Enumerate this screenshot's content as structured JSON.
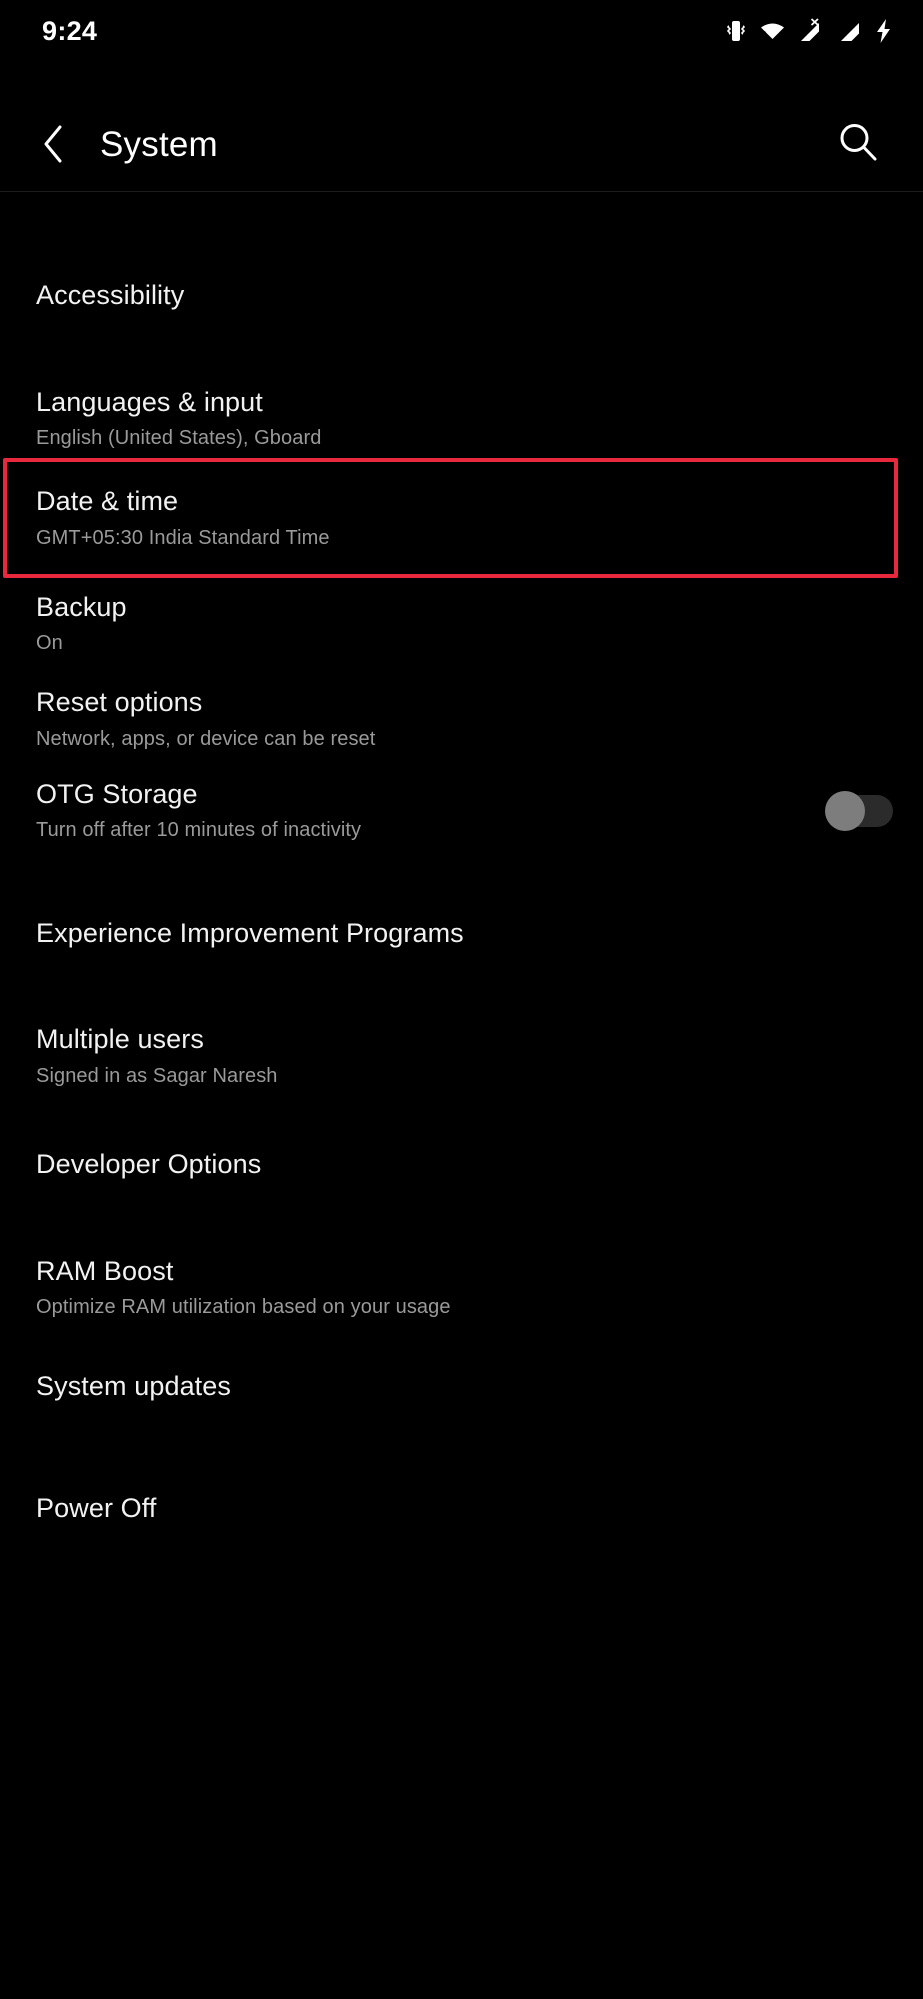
{
  "status_bar": {
    "time": "9:24",
    "icons": [
      "vibrate-icon",
      "wifi-icon",
      "signal-no-service-icon",
      "signal-bars-icon",
      "charging-bolt-icon"
    ]
  },
  "toolbar": {
    "back_icon": "chevron-left-icon",
    "title": "System",
    "search_icon": "search-icon"
  },
  "highlight": {
    "target": "Date & time",
    "color": "#e8283c"
  },
  "list": {
    "items": [
      {
        "title": "Accessibility",
        "subtitle": ""
      },
      {
        "title": "Languages & input",
        "subtitle": "English (United States), Gboard"
      },
      {
        "title": "Date & time",
        "subtitle": "GMT+05:30 India Standard Time"
      },
      {
        "title": "Backup",
        "subtitle": "On"
      },
      {
        "title": "Reset options",
        "subtitle": "Network, apps, or device can be reset"
      },
      {
        "title": "OTG Storage",
        "subtitle": "Turn off after 10 minutes of inactivity",
        "toggle": "off"
      },
      {
        "title": "Experience Improvement Programs",
        "subtitle": ""
      },
      {
        "title": "Multiple users",
        "subtitle": "Signed in as Sagar Naresh"
      },
      {
        "title": "Developer Options",
        "subtitle": ""
      },
      {
        "title": "RAM Boost",
        "subtitle": "Optimize RAM utilization based on your usage"
      },
      {
        "title": "System updates",
        "subtitle": ""
      },
      {
        "title": "Power Off",
        "subtitle": ""
      }
    ]
  }
}
